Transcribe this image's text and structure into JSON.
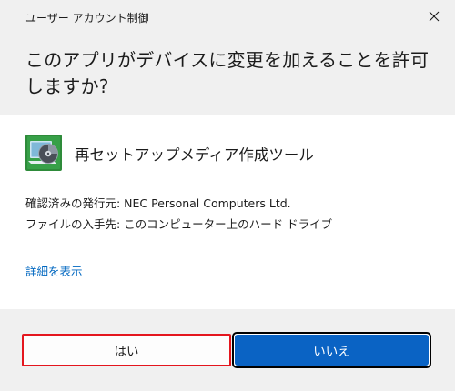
{
  "window": {
    "title": "ユーザー アカウント制御"
  },
  "header": {
    "question": "このアプリがデバイスに変更を加えることを許可しますか?"
  },
  "app": {
    "name": "再セットアップメディア作成ツール",
    "icon": "media-creation-tool-icon"
  },
  "info": {
    "publisher": "確認済みの発行元: NEC Personal Computers  Ltd.",
    "origin": "ファイルの入手先: このコンピューター上のハード ドライブ"
  },
  "details_link": "詳細を表示",
  "buttons": {
    "yes": "はい",
    "no": "いいえ"
  },
  "colors": {
    "accent": "#0a63c4",
    "link": "#0067c0",
    "highlight": "#e4161e",
    "header_bg": "#f0f0f0"
  }
}
